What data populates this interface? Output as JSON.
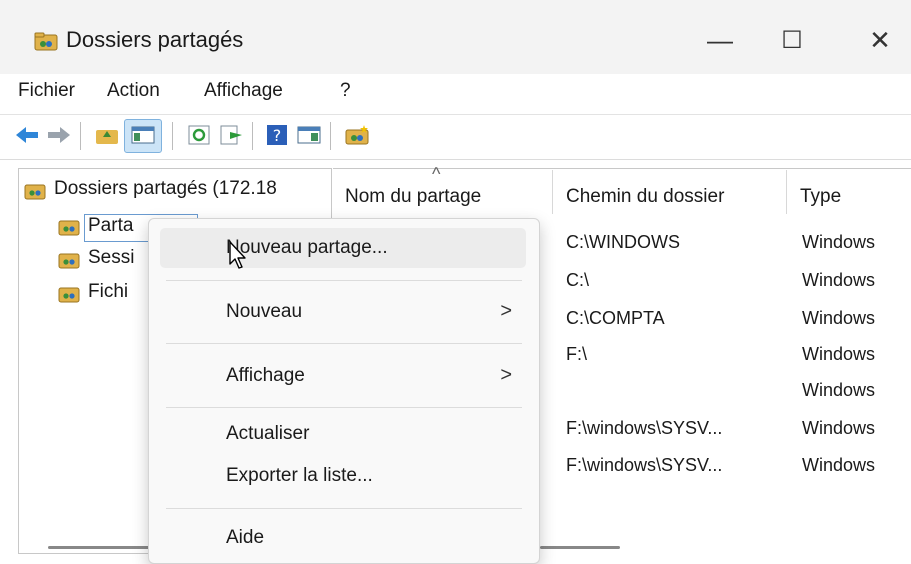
{
  "window": {
    "title": "Dossiers partagés",
    "minimize": "—",
    "maximize": "☐",
    "close": "✕"
  },
  "menubar": [
    "Fichier",
    "Action",
    "Affichage",
    "?"
  ],
  "toolbar_icons": [
    "back-arrow-icon",
    "forward-arrow-icon",
    "up-folder-icon",
    "show-hide-tree-icon",
    "refresh-icon",
    "export-list-icon",
    "help-icon",
    "console-icon",
    "new-share-icon"
  ],
  "tree": {
    "root": "Dossiers partagés (172.18",
    "children": [
      "Partages",
      "Sessions",
      "Fichiers ouverts"
    ],
    "children_visible": [
      "Parta",
      "Sessi",
      "Fichi"
    ]
  },
  "columns": [
    "Nom du partage",
    "Chemin du dossier",
    "Type"
  ],
  "sort_indicator": "^",
  "rows": [
    {
      "path": "C:\\WINDOWS",
      "type": "Windows"
    },
    {
      "path": "C:\\",
      "type": "Windows"
    },
    {
      "path": "C:\\COMPTA",
      "type": "Windows"
    },
    {
      "path": "F:\\",
      "type": "Windows"
    },
    {
      "path": "",
      "type": "Windows"
    },
    {
      "path": "F:\\windows\\SYSV...",
      "type": "Windows"
    },
    {
      "path": "F:\\windows\\SYSV...",
      "type": "Windows"
    }
  ],
  "context_menu": {
    "new_share": "Nouveau partage...",
    "new": "Nouveau",
    "view": "Affichage",
    "refresh": "Actualiser",
    "export": "Exporter la liste...",
    "help": "Aide",
    "submenu_arrow": ">"
  },
  "colors": {
    "accent_folder": "#d9a93a",
    "highlight": "#ececec",
    "selected_tree": "#cce4f7"
  }
}
